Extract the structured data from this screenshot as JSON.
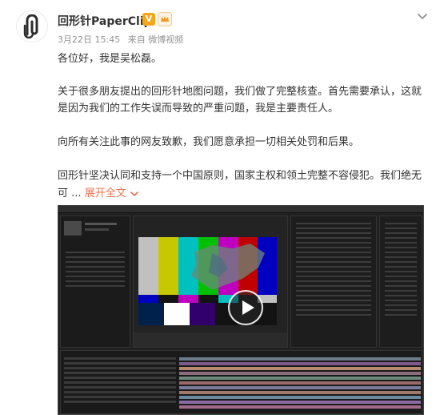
{
  "post": {
    "username": "回形针PaperClip",
    "verified_badge": "V",
    "date": "3月22日 15:45",
    "source": "来自 微博视频",
    "paragraphs": [
      "各位好，我是吴松磊。",
      "关于很多朋友提出的回形针地图问题，我们做了完整核查。首先需要承认，这就是因为我们的工作失误而导致的严重问题，我是主要责任人。",
      "向所有关注此事的网友致歉，我们愿意承担一切相关处罚和后果。",
      "回形针坚决认同和支持一个中国原则，国家主权和领土完整不容侵犯。我们绝无"
    ],
    "truncated_tail": "可",
    "ellipsis": "...",
    "expand_label": "展开全文",
    "icons": {
      "avatar": "paperclip-logo-icon",
      "badge": "crown-badge-icon",
      "menu": "chevron-down-icon",
      "expand": "chevron-down-icon",
      "play": "play-icon"
    }
  },
  "colors": {
    "link": "#eb7350",
    "verified": "#f7a61b",
    "meta": "#939393"
  }
}
